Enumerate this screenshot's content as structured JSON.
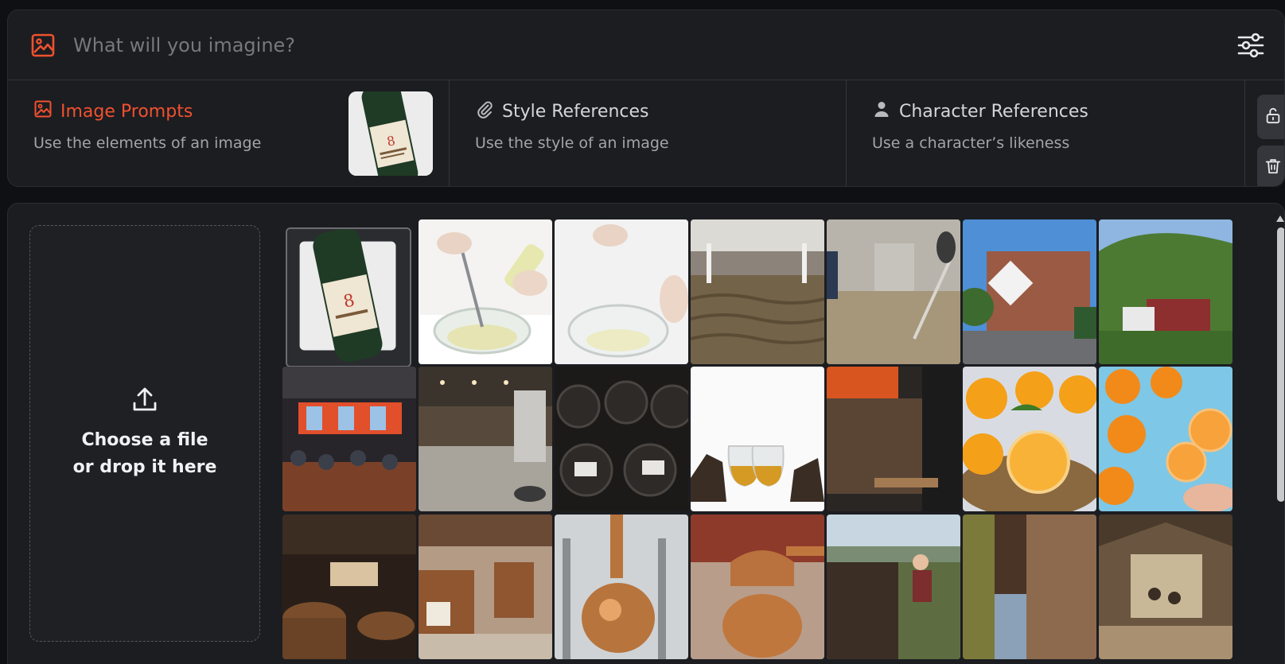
{
  "prompt": {
    "placeholder": "What will you imagine?"
  },
  "tabs": [
    {
      "title": "Image Prompts",
      "subtitle": "Use the elements of an image",
      "active": true
    },
    {
      "title": "Style References",
      "subtitle": "Use the style of an image",
      "active": false
    },
    {
      "title": "Character References",
      "subtitle": "Use a character’s likeness",
      "active": false
    }
  ],
  "dropzone": {
    "text": "Choose a file or drop it here"
  },
  "colors": {
    "accent": "#f0512f",
    "panel": "#1c1d21",
    "background": "#0f1013"
  },
  "icons": {
    "prompt": "image-icon",
    "settings": "sliders-icon",
    "style": "paperclip-icon",
    "character": "person-icon",
    "lock": "unlock-icon",
    "trash": "trash-icon",
    "upload": "upload-icon"
  }
}
